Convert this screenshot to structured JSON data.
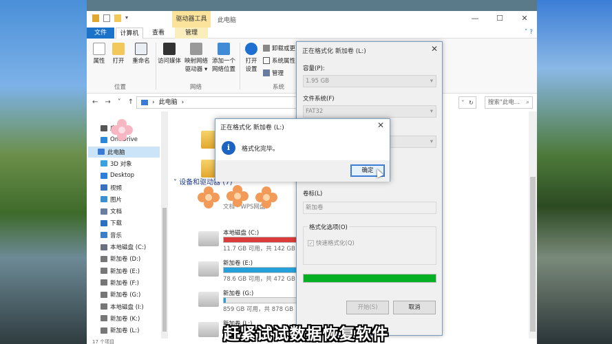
{
  "window": {
    "title": "此电脑",
    "context_tab": "驱动器工具",
    "controls": [
      "—",
      "☐",
      "✕"
    ]
  },
  "tabs": [
    {
      "label": "文件"
    },
    {
      "label": "计算机"
    },
    {
      "label": "查看"
    },
    {
      "label": "管理"
    }
  ],
  "ribbon": {
    "buttons": [
      {
        "label": "属性"
      },
      {
        "label": "打开"
      },
      {
        "label": "重命名"
      },
      {
        "label": "访问媒体"
      },
      {
        "label": "映射网络驱动器 ▾",
        "line1": "映射网络",
        "line2": "驱动器 ▾"
      },
      {
        "label": "添加一个网络位置",
        "line1": "添加一个",
        "line2": "网络位置"
      },
      {
        "label": "打开设置",
        "line1": "打开",
        "line2": "设置"
      }
    ],
    "small_items": [
      "卸载或更",
      "系统属性",
      "管理"
    ],
    "groups": [
      "位置",
      "网络",
      "系统"
    ]
  },
  "address": {
    "path": "此电脑",
    "search_placeholder": "搜索\"此电..."
  },
  "nav": {
    "items": [
      {
        "label": "应用",
        "color": "#555555"
      },
      {
        "label": "OneDrive",
        "color": "#2b88d8"
      },
      {
        "label": "此电脑",
        "color": "#3a7bd5",
        "selected": true
      },
      {
        "label": "3D 对象",
        "color": "#3aa1e0"
      },
      {
        "label": "Desktop",
        "color": "#2b7fd8"
      },
      {
        "label": "视频",
        "color": "#3a70c0"
      },
      {
        "label": "图片",
        "color": "#3a90d0"
      },
      {
        "label": "文档",
        "color": "#6a7fa0"
      },
      {
        "label": "下载",
        "color": "#2b6fc0"
      },
      {
        "label": "音乐",
        "color": "#3a80c8"
      },
      {
        "label": "本地磁盘 (C:)",
        "color": "#6a7080"
      },
      {
        "label": "新加卷 (D:)",
        "color": "#777777"
      },
      {
        "label": "新加卷 (E:)",
        "color": "#777777"
      },
      {
        "label": "新加卷 (F:)",
        "color": "#777777"
      },
      {
        "label": "新加卷 (G:)",
        "color": "#777777"
      },
      {
        "label": "本地磁盘 (I:)",
        "color": "#777777"
      },
      {
        "label": "新加卷 (K:)",
        "color": "#777777"
      },
      {
        "label": "新加卷 (L:)",
        "color": "#777777"
      }
    ]
  },
  "content": {
    "section_header": "设备和驱动器 (7)",
    "wps_label": "文档 - WPS网盘",
    "drives": [
      {
        "name": "本地磁盘 (C:)",
        "size": "11.7 GB 可用，共 142 GB",
        "fill": 0.92,
        "color": "#da3b3b"
      },
      {
        "name": "新加卷 (E:)",
        "size": "78.6 GB 可用，共 472 GB",
        "fill": 0.83,
        "color": "#26a0da"
      },
      {
        "name": "新加卷 (G:)",
        "size": "859 GB 可用，共 878 GB",
        "fill": 0.02,
        "color": "#26a0da"
      },
      {
        "name": "新加卷 (L:)",
        "size": "",
        "fill": 0,
        "color": "#26a0da"
      }
    ]
  },
  "status": {
    "text": "17 个项目"
  },
  "format_dialog": {
    "title": "正在格式化 新加卷 (L:)",
    "capacity_label": "容量(P):",
    "capacity_value": "1.95 GB",
    "fs_label": "文件系统(F)",
    "fs_value": "FAT32",
    "volume_label": "卷标(L)",
    "volume_value": "新加卷",
    "options_label": "格式化选项(O)",
    "quick_format": "快速格式化(Q)",
    "progress": 1.0,
    "start_button": "开始(S)",
    "close_button": "取消"
  },
  "message_box": {
    "title": "正在格式化 新加卷 (L:)",
    "text": "格式化完毕。",
    "ok_button": "确定"
  },
  "caption": "赶紧试试数据恢复软件"
}
